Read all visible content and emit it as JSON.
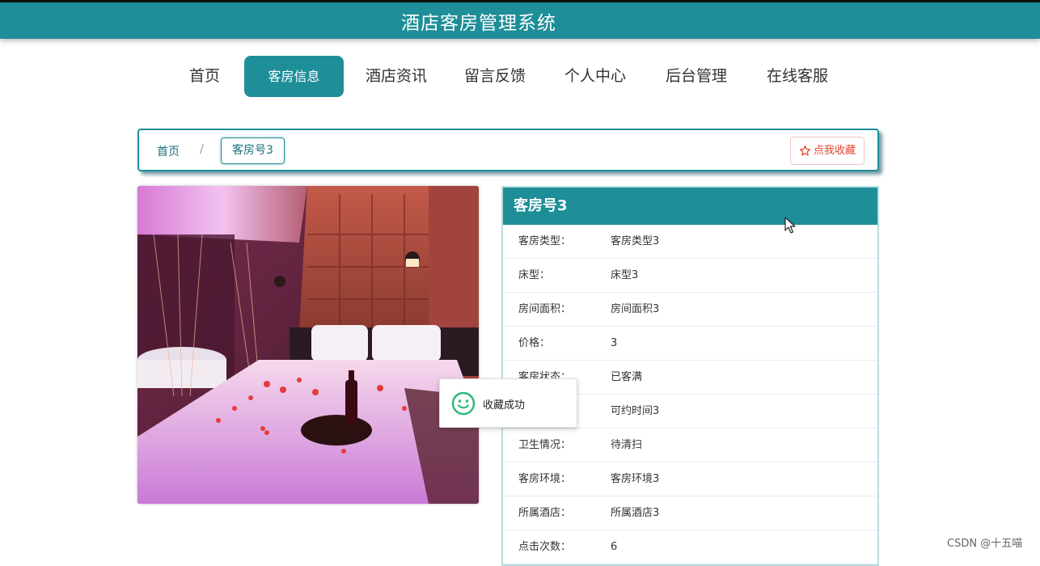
{
  "app": {
    "title": "酒店客房管理系统"
  },
  "nav": {
    "items": [
      {
        "label": "首页"
      },
      {
        "label": "客房信息",
        "active": true
      },
      {
        "label": "酒店资讯"
      },
      {
        "label": "留言反馈"
      },
      {
        "label": "个人中心"
      },
      {
        "label": "后台管理"
      },
      {
        "label": "在线客服"
      }
    ]
  },
  "breadcrumb": {
    "home": "首页",
    "separator": "/",
    "current": "客房号3"
  },
  "favorite_button": {
    "label": "点我收藏",
    "icon": "star-outline-icon"
  },
  "room": {
    "title": "客房号3",
    "fields": [
      {
        "label": "客房类型：",
        "value": "客房类型3"
      },
      {
        "label": "床型：",
        "value": "床型3"
      },
      {
        "label": "房间面积：",
        "value": "房间面积3"
      },
      {
        "label": "价格：",
        "value": "3"
      },
      {
        "label": "客房状态：",
        "value": "已客满"
      },
      {
        "label": "",
        "value": "可约时间3"
      },
      {
        "label": "卫生情况：",
        "value": "待清扫"
      },
      {
        "label": "客房环境：",
        "value": "客房环境3"
      },
      {
        "label": "所属酒店：",
        "value": "所属酒店3"
      },
      {
        "label": "点击次数：",
        "value": "6"
      }
    ]
  },
  "toast": {
    "message": "收藏成功",
    "icon": "smile-icon"
  },
  "watermark": {
    "text": "CSDN @十五喵"
  },
  "colors": {
    "primary": "#1e8e98",
    "favorite": "#e2432e",
    "toast_icon": "#2fb87b"
  }
}
